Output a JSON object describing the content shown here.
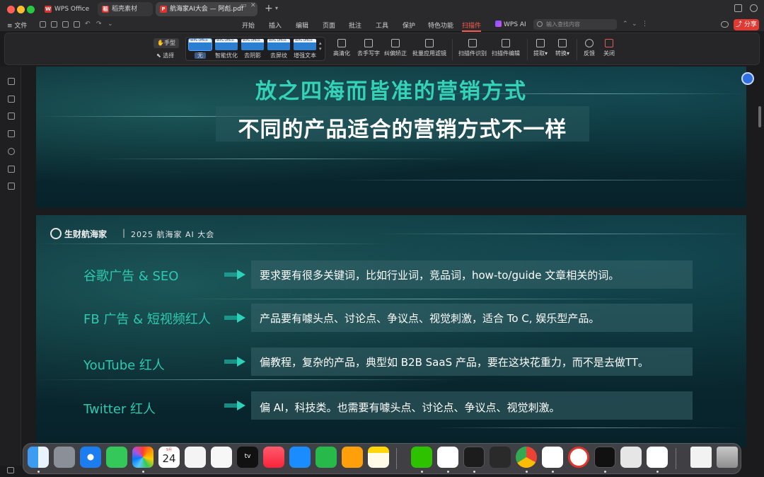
{
  "tabs": [
    {
      "label": "WPS Office"
    },
    {
      "label": "稻壳素材"
    },
    {
      "label": "航海家AI大会 — 阿彪.pdf"
    }
  ],
  "menu": {
    "file_label": "文件",
    "items": [
      "开始",
      "插入",
      "编辑",
      "页面",
      "批注",
      "工具",
      "保护",
      "特色功能",
      "扫描件"
    ],
    "active": "扫描件",
    "wps_ai": "WPS AI",
    "search_placeholder": "输入查找内容",
    "share": "分享"
  },
  "ribbon": {
    "hand": "手型",
    "select": "选择",
    "filters": [
      "无",
      "智能优化",
      "去阴影",
      "去屏纹",
      "增强文本"
    ],
    "selected_filter": "无",
    "buttons": [
      "高清化",
      "去手写字",
      "纠偏矫正",
      "批量应用滤镜",
      "扫描件识别",
      "扫描件编辑",
      "提取",
      "转换",
      "反馈",
      "关闭"
    ]
  },
  "slide1": {
    "heading": "放之四海而皆准的营销方式",
    "subheading": "不同的产品适合的营销方式不一样"
  },
  "slide2": {
    "brand": "生财航海家",
    "divider": "|",
    "event": "2025 航海家 AI 大会",
    "rows": [
      {
        "label": "谷歌广告 & SEO",
        "text": "要求要有很多关键词，比如行业词，竞品词，how-to/guide 文章相关的词。"
      },
      {
        "label": "FB 广告 & 短视频红人",
        "text": "产品要有噱头点、讨论点、争议点、视觉刺激，适合 To C, 娱乐型产品。"
      },
      {
        "label": "YouTube 红人",
        "text": "偏教程，复杂的产品，典型如 B2B SaaS 产品，要在这块花重力，而不是去做TT。"
      },
      {
        "label": "Twitter 红人",
        "text": "偏 AI，科技类。也需要有噱头点、讨论点、争议点、视觉刺激。"
      }
    ]
  },
  "dock": {
    "calendar_month": "9月",
    "calendar_day": "24",
    "tv_label": "tv",
    "apps": [
      "finder-icon",
      "launchpad-icon",
      "safari-icon",
      "messages-icon",
      "photos-icon",
      "calendar-icon",
      "reminders-icon",
      "freeform-icon",
      "apple-tv-icon",
      "music-icon",
      "keynote-icon",
      "numbers-icon",
      "pages-icon",
      "notes-icon",
      "wechat-icon",
      "lark-icon",
      "terminal-icon",
      "cube-app-icon",
      "chrome-icon",
      "chatgpt-icon",
      "app-red-icon",
      "terminal-dark-icon",
      "script-editor-icon",
      "wps-icon",
      "file-icon",
      "trash-icon"
    ]
  },
  "colors": {
    "accent": "#ff5c4d",
    "teal_heading": "#34d3b8",
    "teal_label": "#2dc9b0",
    "share": "#e23a33"
  }
}
